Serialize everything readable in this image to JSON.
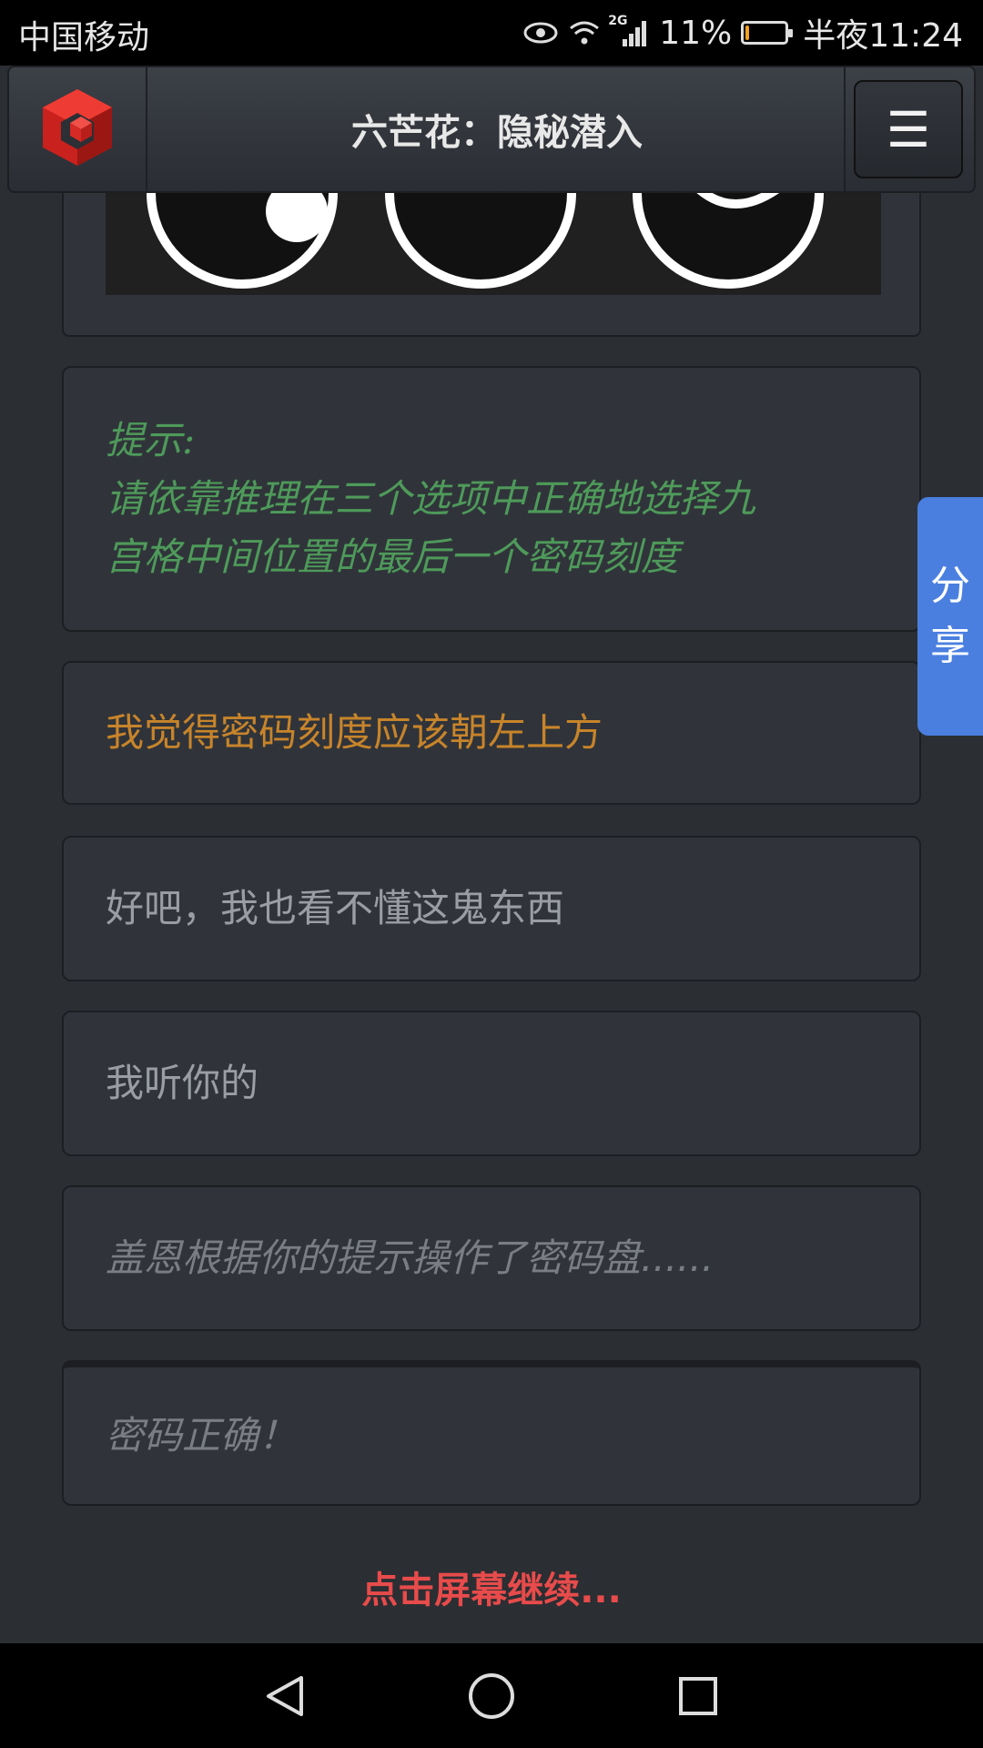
{
  "status_bar": {
    "carrier": "中国移动",
    "network": "2G",
    "battery_percent": "11%",
    "battery_level": 0.11,
    "time": "半夜11:24",
    "colors": {
      "battery": "#f2a01e"
    }
  },
  "header": {
    "title": "六芒花：隐秘潜入",
    "menu_icon": "☰",
    "logo_icon": "red-cube-logo-icon"
  },
  "dialogue": [
    {
      "style": "hint",
      "lines": [
        "提示:",
        "请依靠推理在三个选项中正确地选择九",
        "宫格中间位置的最后一个密码刻度"
      ]
    },
    {
      "style": "choice-highlight",
      "text": "我觉得密码刻度应该朝左上方"
    },
    {
      "style": "choice",
      "text": "好吧，我也看不懂这鬼东西"
    },
    {
      "style": "choice",
      "text": "我听你的"
    },
    {
      "style": "narration",
      "text": "盖恩根据你的提示操作了密码盘......"
    },
    {
      "style": "narration",
      "text": "密码正确！"
    }
  ],
  "continue_prompt": "点击屏幕继续...",
  "share_tab": {
    "label_top": "分",
    "label_bottom": "享"
  },
  "nav_bar": {
    "icons": [
      "back-icon",
      "home-icon",
      "recents-icon"
    ]
  },
  "colors": {
    "background": "#2b2e33",
    "card": "#30343a",
    "hint": "#4e9a5a",
    "highlight": "#c8842a",
    "continue": "#e84b4b",
    "share": "#4a7fe0"
  }
}
